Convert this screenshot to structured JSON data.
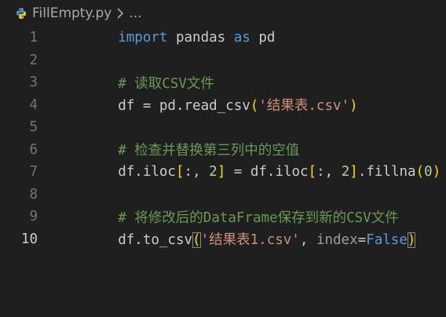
{
  "breadcrumb": {
    "file": "FillEmpty.py",
    "separator_icon": "chevron-right-icon",
    "more": "..."
  },
  "colors": {
    "background": "#1f1f1f",
    "keyword": "#569cd6",
    "string": "#ce9178",
    "number": "#b5cea8",
    "comment": "#6a9955",
    "bracket_yellow": "#ffd700",
    "line_number": "#6e7681"
  },
  "lines": [
    {
      "n": "1",
      "tokens": {
        "t1": "import",
        "t2": " pandas ",
        "t3": "as",
        "t4": " pd"
      }
    },
    {
      "n": "2"
    },
    {
      "n": "3",
      "tokens": {
        "t1": "# 读取CSV文件"
      }
    },
    {
      "n": "4",
      "tokens": {
        "t1": "df = pd.read_csv",
        "t2": "(",
        "t3": "'结果表.csv'",
        "t4": ")"
      }
    },
    {
      "n": "5"
    },
    {
      "n": "6",
      "tokens": {
        "t1": "# 检查并替换第三列中的空值"
      }
    },
    {
      "n": "7",
      "tokens": {
        "t1": "df.iloc",
        "t2": "[",
        "t3": ":, ",
        "t4": "2",
        "t5": "]",
        "t6": " = df.iloc",
        "t7": "[",
        "t8": ":, ",
        "t9": "2",
        "t10": "]",
        "t11": ".fillna",
        "t12": "(",
        "t13": "0",
        "t14": ")"
      }
    },
    {
      "n": "8"
    },
    {
      "n": "9",
      "tokens": {
        "t1": "# 将修改后的DataFrame保存到新的CSV文件"
      }
    },
    {
      "n": "10",
      "tokens": {
        "t1": "df.to_csv",
        "t2": "(",
        "t3": "'结果表1.csv'",
        "t4": ", ",
        "t5": "index",
        "t6": "=",
        "t7": "False",
        "t8": ")"
      }
    }
  ]
}
